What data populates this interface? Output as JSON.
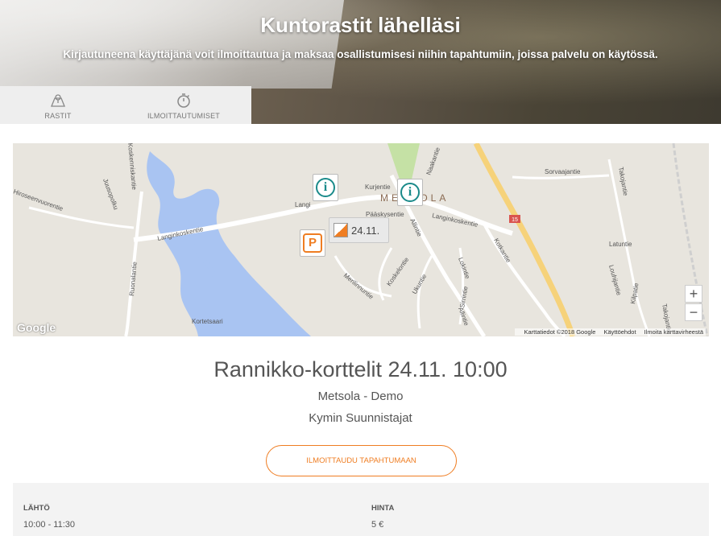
{
  "hero": {
    "title": "Kuntorastit lähelläsi",
    "subtitle": "Kirjautuneena käyttäjänä voit ilmoittautua ja maksaa osallistumisesi niihin tapahtumiin, joissa palvelu on käytössä."
  },
  "tabs": [
    {
      "label": "RASTIT",
      "icon": "map-icon"
    },
    {
      "label": "ILMOITTAUTUMISET",
      "icon": "stopwatch-icon"
    }
  ],
  "map": {
    "roads": {
      "langinkoskentie_west": "Langinkoskentie",
      "langinkoskentie_east": "Langinkoskentie",
      "kurjentie": "Kurjentie",
      "paaskysentie": "Pääskysentie",
      "naakantie": "Naakantie",
      "sorvaajantie": "Sorvaajantie",
      "takojantie": "Takojantie",
      "latuntie": "Latuntie",
      "louhijantie": "Louhijantie",
      "kotkantie": "Kotkantie",
      "lokintie": "Lokintie",
      "sirrintie": "Sirrintie",
      "koskelontie": "Koskelontie",
      "merilinnuntie": "Merilinnuntie",
      "ukuntie": "Ukuntie",
      "allintie": "Allintie",
      "ruonalantie": "Ruonalantie",
      "juusopolku": "Juusopolku",
      "koskenniskantie": "Koskenniskantie",
      "hiroseenvuorentie": "Hiroseenvuorentie",
      "kilpatie": "Kilpatie",
      "route": "15"
    },
    "places": {
      "area": "METSOLA",
      "island": "Kortetsaari",
      "langi": "Langi"
    },
    "marker_date": "24.11.",
    "parking_label": "P",
    "info_label": "i",
    "zoom_in": "+",
    "zoom_out": "−",
    "logo": "Google",
    "attribution": [
      "Karttatiedot ©2018 Google",
      "Käyttöehdot",
      "Ilmoita karttavirheestä"
    ]
  },
  "event": {
    "title": "Rannikko-korttelit 24.11. 10:00",
    "venue": "Metsola - Demo",
    "organizer": "Kymin Suunnistajat",
    "register_label": "ILMOITTAUDU TAPAHTUMAAN"
  },
  "details": {
    "start_label": "LÄHTÖ",
    "start_value": "10:00 - 11:30",
    "price_label": "HINTA",
    "price_value": "5 €"
  },
  "colors": {
    "accent": "#ef7d22",
    "info_marker": "#1a8a8a",
    "water": "#a9c4f2"
  }
}
